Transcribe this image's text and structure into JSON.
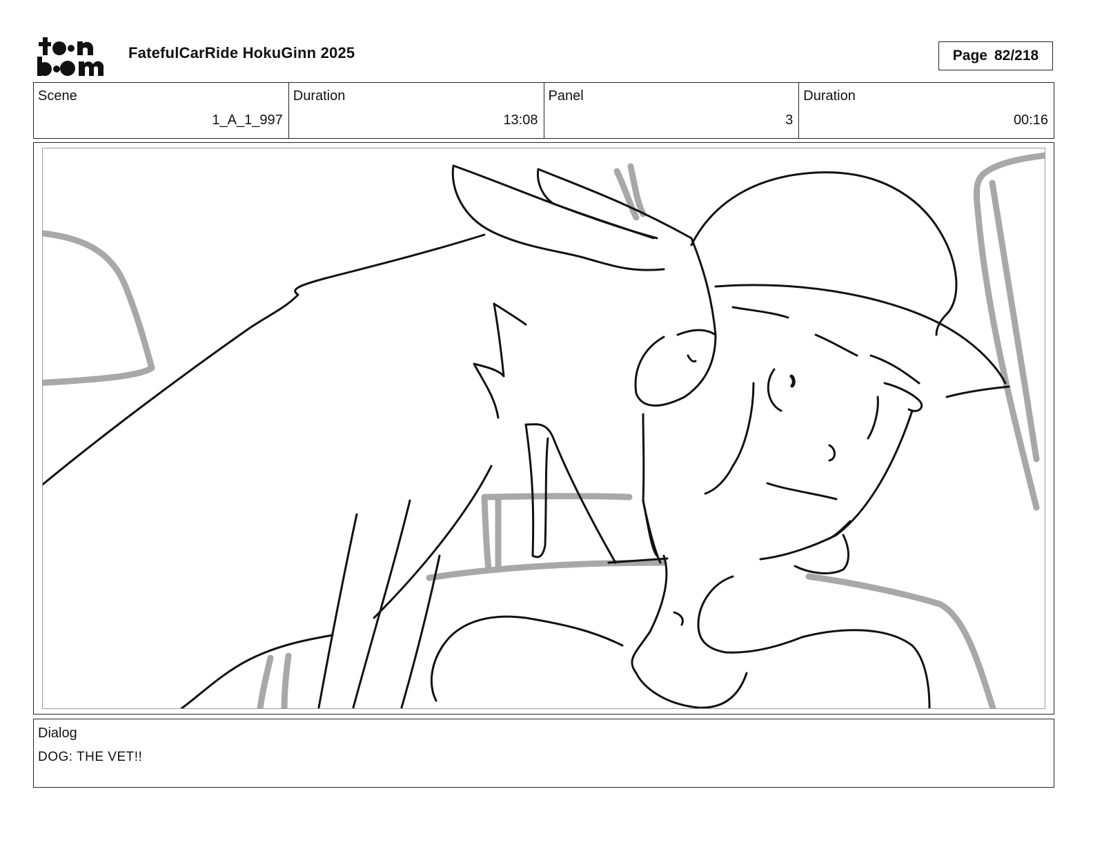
{
  "header": {
    "logo_text": "toonboom",
    "title": "FatefulCarRide HokuGinn 2025",
    "page_label": "Page",
    "page_value": "82/218"
  },
  "meta": {
    "scene_label": "Scene",
    "scene_value": "1_A_1_997",
    "scene_duration_label": "Duration",
    "scene_duration_value": "13:08",
    "panel_label": "Panel",
    "panel_value": "3",
    "panel_duration_label": "Duration",
    "panel_duration_value": "00:16"
  },
  "dialog": {
    "label": "Dialog",
    "text": "DOG: THE VET!!"
  },
  "colors": {
    "ink": "#111111",
    "background_ink": "#a8a8a8",
    "frame": "#222222"
  }
}
